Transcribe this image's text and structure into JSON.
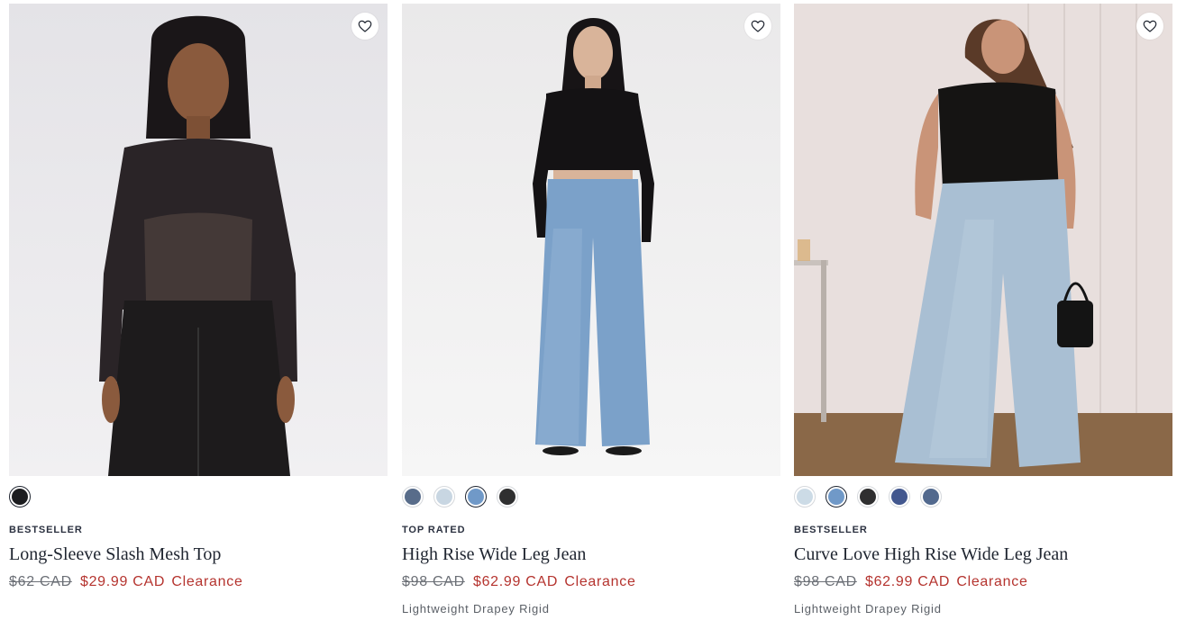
{
  "products": [
    {
      "badge": "BESTSELLER",
      "name": "Long-Sleeve Slash Mesh Top",
      "was_price": "$62 CAD",
      "now_price": "$29.99 CAD",
      "sale_tag": "Clearance",
      "fit": "",
      "swatches": [
        {
          "color": "#1c1d20",
          "selected": true
        }
      ]
    },
    {
      "badge": "TOP RATED",
      "name": "High Rise Wide Leg Jean",
      "was_price": "$98 CAD",
      "now_price": "$62.99 CAD",
      "sale_tag": "Clearance",
      "fit": "Lightweight Drapey Rigid",
      "swatches": [
        {
          "color": "#586c8a",
          "selected": false
        },
        {
          "color": "#c8d6e2",
          "selected": false
        },
        {
          "color": "#7099c8",
          "selected": true
        },
        {
          "color": "#2f2f30",
          "selected": false
        }
      ]
    },
    {
      "badge": "BESTSELLER",
      "name": "Curve Love High Rise Wide Leg Jean",
      "was_price": "$98 CAD",
      "now_price": "$62.99 CAD",
      "sale_tag": "Clearance",
      "fit": "Lightweight Drapey Rigid",
      "swatches": [
        {
          "color": "#ccdbe6",
          "selected": false
        },
        {
          "color": "#7099c8",
          "selected": true
        },
        {
          "color": "#2f2f30",
          "selected": false
        },
        {
          "color": "#42578e",
          "selected": false
        },
        {
          "color": "#52698e",
          "selected": false
        }
      ]
    }
  ],
  "colors": {
    "sale_red": "#b5342f",
    "text_dark": "#1f2530",
    "text_muted": "#5a5f66"
  },
  "icons": {
    "favorite": "heart-outline-icon"
  }
}
